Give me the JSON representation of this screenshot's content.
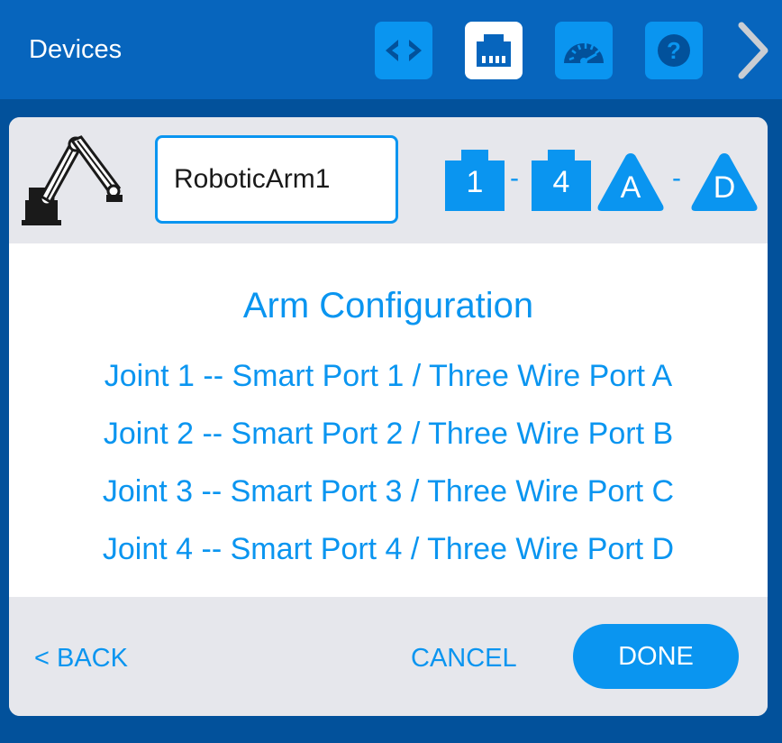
{
  "header": {
    "title": "Devices",
    "tools": [
      {
        "icon": "code-brackets-icon"
      },
      {
        "icon": "ethernet-port-icon",
        "active": true
      },
      {
        "icon": "dashboard-gauge-icon"
      },
      {
        "icon": "help-icon",
        "glyph": "?"
      }
    ],
    "next_icon": "chevron-right-icon"
  },
  "device": {
    "icon": "robotic-arm-icon",
    "name": "RoboticArm1",
    "smart_port_start": "1",
    "smart_port_end": "4",
    "three_wire_start": "A",
    "three_wire_end": "D",
    "separator": "-"
  },
  "content": {
    "title": "Arm Configuration",
    "joints": [
      "Joint 1 -- Smart Port 1 / Three Wire Port A",
      "Joint 2 -- Smart Port 2 / Three Wire Port B",
      "Joint 3 -- Smart Port 3 / Three Wire Port C",
      "Joint 4 -- Smart Port 4 / Three Wire Port D"
    ]
  },
  "footer": {
    "back_label": "< BACK",
    "cancel_label": "CANCEL",
    "done_label": "DONE"
  },
  "colors": {
    "background": "#02519b",
    "header": "#0765bd",
    "accent": "#0a95f0",
    "panel": "#e6e7ec",
    "white": "#ffffff"
  }
}
